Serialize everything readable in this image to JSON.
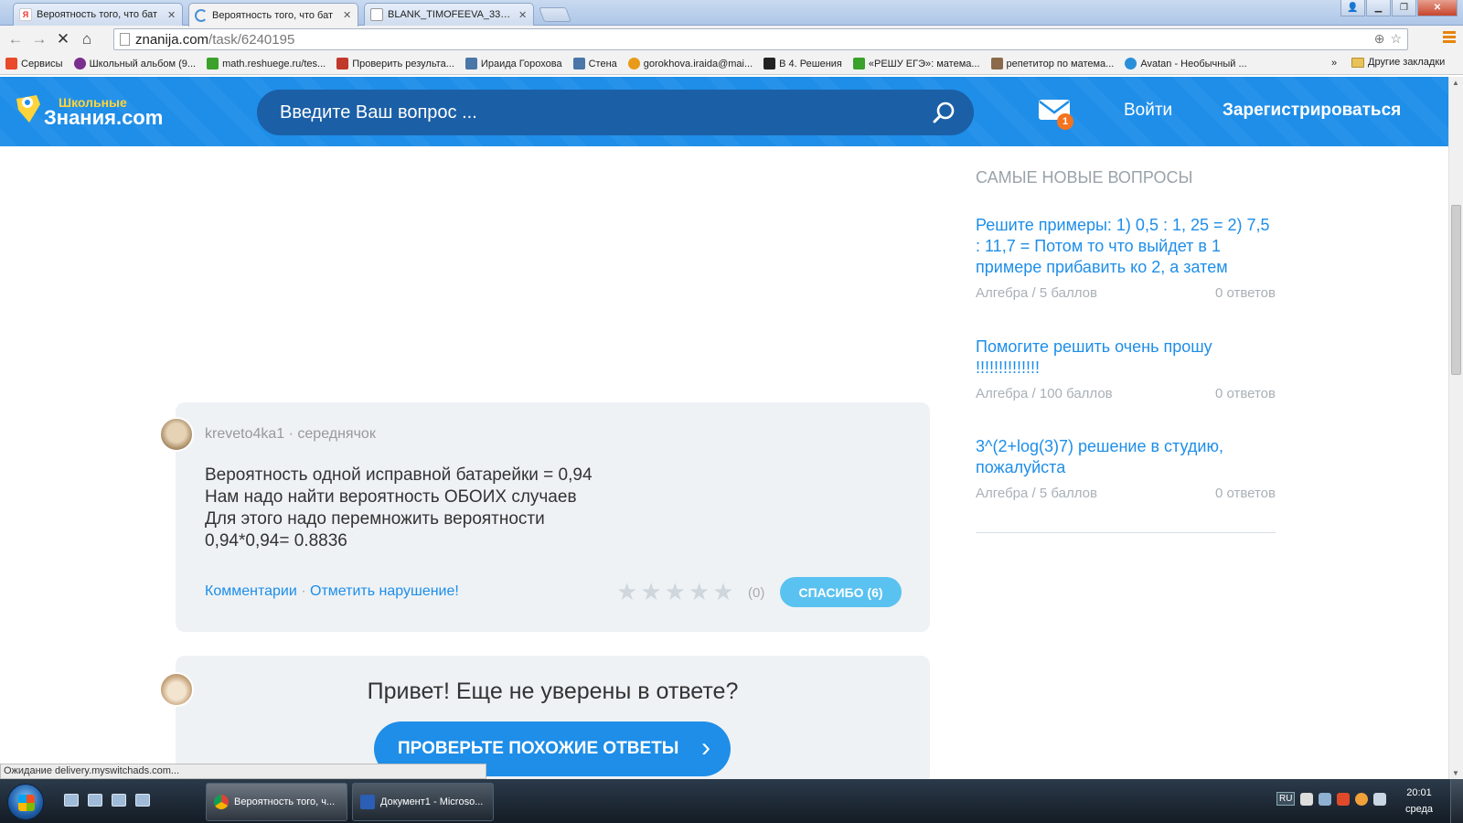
{
  "browser": {
    "tabs": [
      {
        "label": "Вероятность того, что бат",
        "favicon": "yandex-icon",
        "active": false
      },
      {
        "label": "Вероятность того, что бат",
        "favicon": "loading-icon",
        "active": true
      },
      {
        "label": "BLANK_TIMOFEEVA_33___3",
        "favicon": "document-icon",
        "active": false
      }
    ],
    "url_host": "znanija.com",
    "url_path": "/task/6240195",
    "bookmarks": [
      {
        "label": "Сервисы",
        "color": "#e84a2a"
      },
      {
        "label": "Школьный альбом (9...",
        "color": "#7a2e8f"
      },
      {
        "label": "math.reshuege.ru/tes...",
        "color": "#3aa12a"
      },
      {
        "label": "Проверить результа...",
        "color": "#c0392b"
      },
      {
        "label": "Ираида Горохова",
        "color": "#4a76a8"
      },
      {
        "label": "Стена",
        "color": "#4a76a8"
      },
      {
        "label": "gorokhova.iraida@mai...",
        "color": "#e89a1a"
      },
      {
        "label": "В 4. Решения",
        "color": "#222222"
      },
      {
        "label": "«РЕШУ ЕГЭ»: матема...",
        "color": "#3aa12a"
      },
      {
        "label": "репетитор по матема...",
        "color": "#8a6a4a"
      },
      {
        "label": "Avatan - Необычный ...",
        "color": "#2a8fd8"
      }
    ],
    "bookmarks_more": "»",
    "other_bookmarks": "Другие закладки",
    "status_text": "Ожидание delivery.myswitchads.com..."
  },
  "site": {
    "logo_small": "Школьные",
    "logo_big": "Знания.com",
    "search_placeholder": "Введите Ваш вопрос ...",
    "mail_badge": "1",
    "login": "Войти",
    "register": "Зарегистрироваться",
    "brand_color": "#1e8ee8"
  },
  "answer": {
    "author": "kreveto4ka1",
    "rank": "середнячок",
    "lines": [
      "Вероятность одной исправной батарейки = 0,94",
      "Нам надо найти вероятность ОБОИХ случаев",
      "Для этого надо перемножить вероятности",
      "0,94*0,94= 0.8836"
    ],
    "comments": "Комментарии",
    "report": "Отметить нарушение!",
    "rating_count": "(0)",
    "rating_stars": 0,
    "thanks": "СПАСИБО (6)"
  },
  "promo": {
    "title": "Привет! Еще не уверены в ответе?",
    "button": "ПРОВЕРЬТЕ ПОХОЖИЕ ОТВЕТЫ"
  },
  "sidebar": {
    "title": "САМЫЕ НОВЫЕ ВОПРОСЫ",
    "questions": [
      {
        "title": "Решите примеры: 1) 0,5 : 1, 25 = 2) 7,5 : 11,7 = Потом то что выйдет в 1 примере прибавить ко 2, а затем",
        "subject": "Алгебра",
        "points": "5 баллов",
        "answers": "0 ответов"
      },
      {
        "title": "Помогите решить очень прошу !!!!!!!!!!!!!!",
        "subject": "Алгебра",
        "points": "100 баллов",
        "answers": "0 ответов"
      },
      {
        "title": "3^(2+log(3)7) решение в студию, пожалуйста",
        "subject": "Алгебра",
        "points": "5 баллов",
        "answers": "0 ответов"
      }
    ]
  },
  "taskbar": {
    "tasks": [
      {
        "label": "Вероятность того, ч...",
        "active": true
      },
      {
        "label": "Документ1 - Microso...",
        "active": false
      }
    ],
    "lang": "RU",
    "time": "20:01",
    "day": "среда"
  }
}
